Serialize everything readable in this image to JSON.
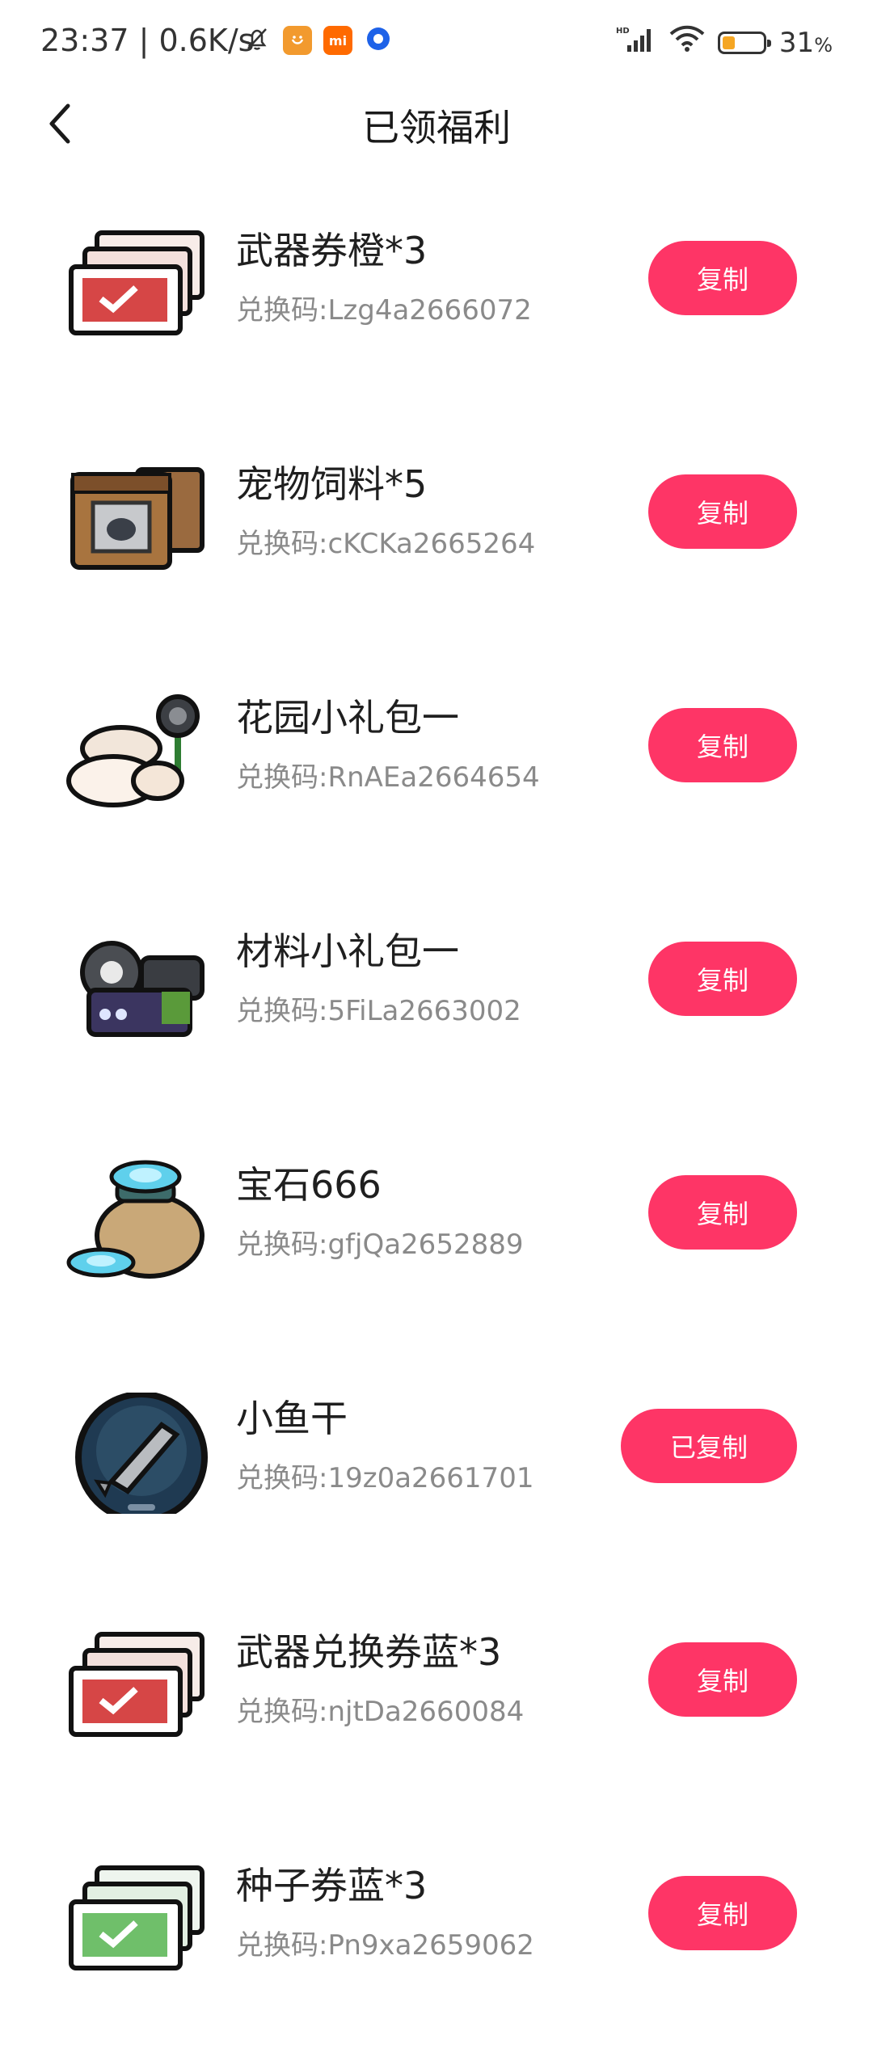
{
  "status_bar": {
    "time": "23:37",
    "speed": "0.6K/s",
    "battery": "31",
    "battery_unit": "%",
    "battery_level": 0.31,
    "icons": [
      "mute-bell-icon",
      "app-face-icon",
      "mi-icon",
      "browser-dot-icon",
      "hd-signal-icon",
      "wifi-icon",
      "battery-icon"
    ]
  },
  "header": {
    "title": "已领福利",
    "back_icon": "chevron-left-icon"
  },
  "colors": {
    "accent": "#fe3566",
    "text_primary": "#1f1f1f",
    "text_secondary": "#8a8a8a"
  },
  "code_prefix": "兑换码:",
  "items": [
    {
      "name": "武器券橙*3",
      "code": "兑换码:Lzg4a2666072",
      "button": "复制",
      "icon": "weapon-ticket-red-icon"
    },
    {
      "name": "宠物饲料*5",
      "code": "兑换码:cKCKa2665264",
      "button": "复制",
      "icon": "pet-food-bag-icon"
    },
    {
      "name": "花园小礼包一",
      "code": "兑换码:RnAEa2664654",
      "button": "复制",
      "icon": "garden-gift-pack-icon"
    },
    {
      "name": "材料小礼包一",
      "code": "兑换码:5FiLa2663002",
      "button": "复制",
      "icon": "material-gift-pack-icon"
    },
    {
      "name": "宝石666",
      "code": "兑换码:gfjQa2652889",
      "button": "复制",
      "icon": "gem-bag-icon"
    },
    {
      "name": "小鱼干",
      "code": "兑换码:19z0a2661701",
      "button": "已复制",
      "icon": "dried-fish-icon"
    },
    {
      "name": "武器兑换券蓝*3",
      "code": "兑换码:njtDa2660084",
      "button": "复制",
      "icon": "weapon-ticket-red-icon"
    },
    {
      "name": "种子券蓝*3",
      "code": "兑换码:Pn9xa2659062",
      "button": "复制",
      "icon": "seed-ticket-green-icon"
    }
  ]
}
